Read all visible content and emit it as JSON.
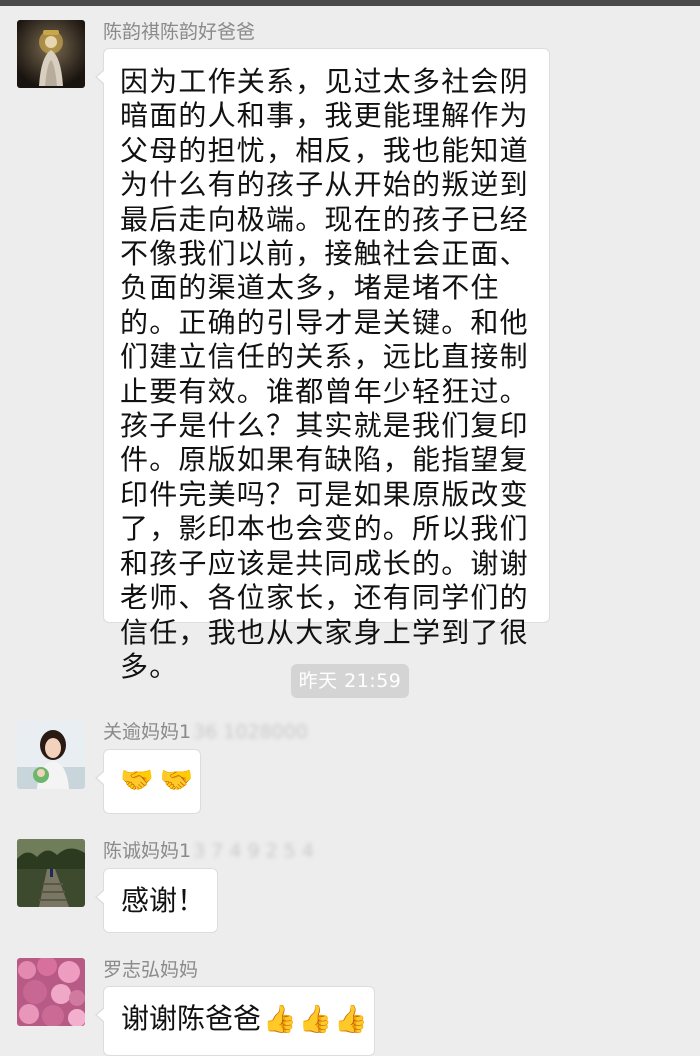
{
  "messages": [
    {
      "sender": "陈韵祺陈韵好爸爸",
      "text": "因为工作关系，见过太多社会阴暗面的人和事，我更能理解作为父母的担忧，相反，我也能知道为什么有的孩子从开始的叛逆到最后走向极端。现在的孩子已经不像我们以前，接触社会正面、负面的渠道太多，堵是堵不住的。正确的引导才是关键。和他们建立信任的关系，远比直接制止要有效。谁都曾年少轻狂过。孩子是什么？其实就是我们复印件。原版如果有缺陷，能指望复印件完美吗？可是如果原版改变了，影印本也会变的。所以我们和孩子应该是共同成长的。谢谢老师、各位家长，还有同学们的信任，我也从大家身上学到了很多。"
    },
    {
      "sender": "关逾妈妈1",
      "sender_obscured": "36 1028000",
      "emojis": [
        "🤝",
        "🤝"
      ]
    },
    {
      "sender": "陈诚妈妈1",
      "sender_obscured": "3 7 4 9 2 5 4",
      "text": "感谢！"
    },
    {
      "sender": "罗志弘妈妈",
      "text": "谢谢陈爸爸",
      "emojis": [
        "👍",
        "👍",
        "👍"
      ]
    }
  ],
  "timestamp": "昨天 21:59",
  "icons": {
    "avatar1": "deity-statue-avatar",
    "avatar2": "girl-photo-avatar",
    "avatar3": "forest-path-avatar",
    "avatar4": "pink-blossoms-avatar"
  }
}
